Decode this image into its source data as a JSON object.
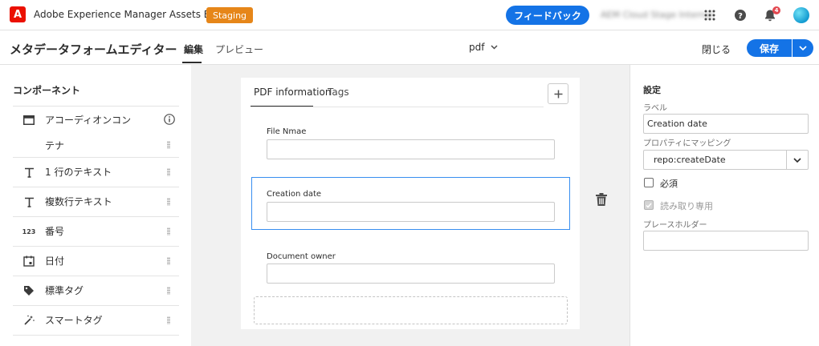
{
  "topbar": {
    "logo_letter": "A",
    "app_title": "Adobe Experience Manager Assets Essentials",
    "env_badge": "Staging",
    "feedback_label": "フィードバック",
    "org_name": "AEM Cloud Stage Internal",
    "notification_count": "4",
    "icons": [
      "app-grid-icon",
      "help-icon",
      "bell-icon",
      "avatar"
    ]
  },
  "header": {
    "page_title": "メタデータフォームエディター",
    "tabs": [
      {
        "label": "編集",
        "active": true
      },
      {
        "label": "プレビュー",
        "active": false
      }
    ],
    "schema_selector": "pdf",
    "close_label": "閉じる",
    "save_label": "保存"
  },
  "components_panel": {
    "title": "コンポーネント",
    "items": [
      {
        "icon": "accordion-icon",
        "label": "アコーディオンコン",
        "label_line2": "テナ",
        "has_info": true
      },
      {
        "icon": "text-icon",
        "label": "1 行のテキスト"
      },
      {
        "icon": "text-icon",
        "label": "複数行テキスト"
      },
      {
        "icon": "number-icon",
        "icon_text": "123",
        "label": "番号"
      },
      {
        "icon": "calendar-icon",
        "label": "日付"
      },
      {
        "icon": "tag-icon",
        "label": "標準タグ"
      },
      {
        "icon": "magic-wand-icon",
        "label": "スマートタグ"
      }
    ]
  },
  "form": {
    "tabs": [
      {
        "label": "PDF information",
        "active": true
      },
      {
        "label": "Tags",
        "active": false
      }
    ],
    "fields": [
      {
        "label": "File Nmae",
        "value": ""
      },
      {
        "label": "Creation date",
        "value": "",
        "selected": true
      },
      {
        "label": "Document owner",
        "value": ""
      }
    ]
  },
  "settings_panel": {
    "title": "設定",
    "label_caption": "ラベル",
    "label_value": "Creation date",
    "mapping_caption": "プロパティにマッピング",
    "mapping_value": "repo:createDate",
    "required_label": "必須",
    "required_checked": false,
    "readonly_label": "読み取り専用",
    "readonly_checked": true,
    "placeholder_caption": "プレースホルダー",
    "placeholder_value": ""
  },
  "colors": {
    "accent": "#1473e6",
    "staging_badge": "#e68619",
    "adobe_red": "#eb1000",
    "selection_border": "#378ef0"
  }
}
